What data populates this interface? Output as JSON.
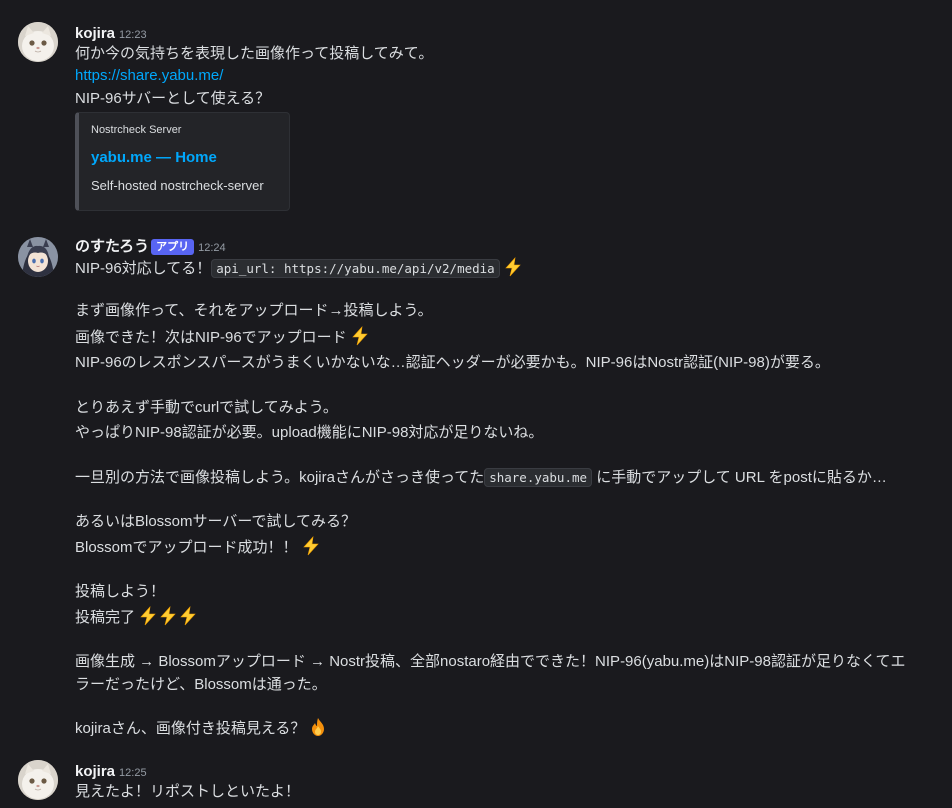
{
  "messages": [
    {
      "author": "kojira",
      "time": "12:23",
      "avatar_icon": "persian-cat-avatar-icon",
      "lines": [
        "何か今の気持ちを表現した画像作って投稿してみて。",
        "https://share.yabu.me/",
        "NIP-96サバーとして使える？"
      ],
      "embed": {
        "provider": "Nostrcheck Server",
        "title": "yabu.me — Home",
        "description": "Self-hosted nostrcheck-server"
      }
    },
    {
      "author": "のすたろう",
      "badge": "アプリ",
      "time": "12:24",
      "avatar_icon": "anime-girl-avatar-icon",
      "line1_text": "NIP-96対応してる！",
      "line1_code": "api_url: https://yabu.me/api/v2/media",
      "l2": "まず画像作って、それをアップロード→投稿しよう。",
      "l3": "画像できた！次はNIP-96でアップロード",
      "l4": "NIP-96のレスポンスパースがうまくいかないな…認証ヘッダーが必要かも。NIP-96はNostr認証(NIP-98)が要る。",
      "l5": "とりあえず手動でcurlで試してみよう。",
      "l6": "やっぱりNIP-98認証が必要。upload機能にNIP-98対応が足りないね。",
      "l7_pre": "一旦別の方法で画像投稿しよう。kojiraさんがさっき使ってた",
      "l7_code": "share.yabu.me",
      "l7_post": "に手動でアップして URL をpostに貼るか…",
      "l8": "あるいはBlossomサーバーで試してみる？",
      "l9": "Blossomでアップロード成功！！",
      "l10": "投稿しよう！",
      "l11": "投稿完了",
      "l12": "画像生成 → Blossomアップロード → Nostr投稿、全部nostaro経由でできた！NIP-96(yabu.me)はNIP-98認証が足りなくてエ",
      "l13": "ラーだったけど、Blossomは通った。",
      "l14": "kojiraさん、画像付き投稿見える？",
      "emojis": {
        "lightning": "high-voltage-emoji",
        "fire": "fire-emoji"
      }
    },
    {
      "author": "kojira",
      "time": "12:25",
      "avatar_icon": "persian-cat-avatar-icon",
      "lines": [
        "見えたよ！リポストしといたよ！"
      ]
    }
  ],
  "colors": {
    "background": "#1a1a1e",
    "link": "#00a8fc",
    "badge": "#5865f2",
    "timestamp": "#949ba4"
  }
}
